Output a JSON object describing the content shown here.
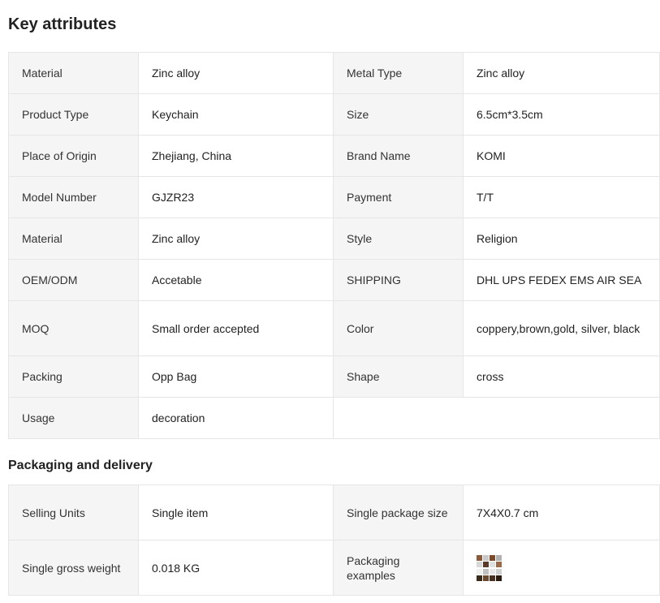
{
  "key_attributes": {
    "title": "Key attributes",
    "rows": [
      [
        {
          "label": "Material",
          "value": "Zinc alloy"
        },
        {
          "label": "Metal Type",
          "value": "Zinc alloy"
        }
      ],
      [
        {
          "label": "Product Type",
          "value": "Keychain"
        },
        {
          "label": "Size",
          "value": "6.5cm*3.5cm"
        }
      ],
      [
        {
          "label": "Place of Origin",
          "value": "Zhejiang, China"
        },
        {
          "label": "Brand Name",
          "value": "KOMI"
        }
      ],
      [
        {
          "label": "Model Number",
          "value": "GJZR23"
        },
        {
          "label": "Payment",
          "value": "T/T"
        }
      ],
      [
        {
          "label": "Material",
          "value": "Zinc alloy"
        },
        {
          "label": "Style",
          "value": "Religion"
        }
      ],
      [
        {
          "label": "OEM/ODM",
          "value": "Accetable"
        },
        {
          "label": "SHIPPING",
          "value": "DHL UPS FEDEX EMS AIR SEA"
        }
      ],
      [
        {
          "label": "MOQ",
          "value": "Small order accepted"
        },
        {
          "label": "Color",
          "value": "coppery,brown,gold, silver, black"
        }
      ],
      [
        {
          "label": "Packing",
          "value": "Opp Bag"
        },
        {
          "label": "Shape",
          "value": "cross"
        }
      ],
      [
        {
          "label": "Usage",
          "value": "decoration"
        }
      ]
    ]
  },
  "packaging_delivery": {
    "title": "Packaging and delivery",
    "rows": [
      [
        {
          "label": "Selling Units",
          "value": "Single item"
        },
        {
          "label": "Single package size",
          "value": "7X4X0.7 cm"
        }
      ],
      [
        {
          "label": "Single gross weight",
          "value": "0.018 KG"
        },
        {
          "label": "Packaging examples",
          "image": "packaging-thumbnail"
        }
      ]
    ]
  }
}
